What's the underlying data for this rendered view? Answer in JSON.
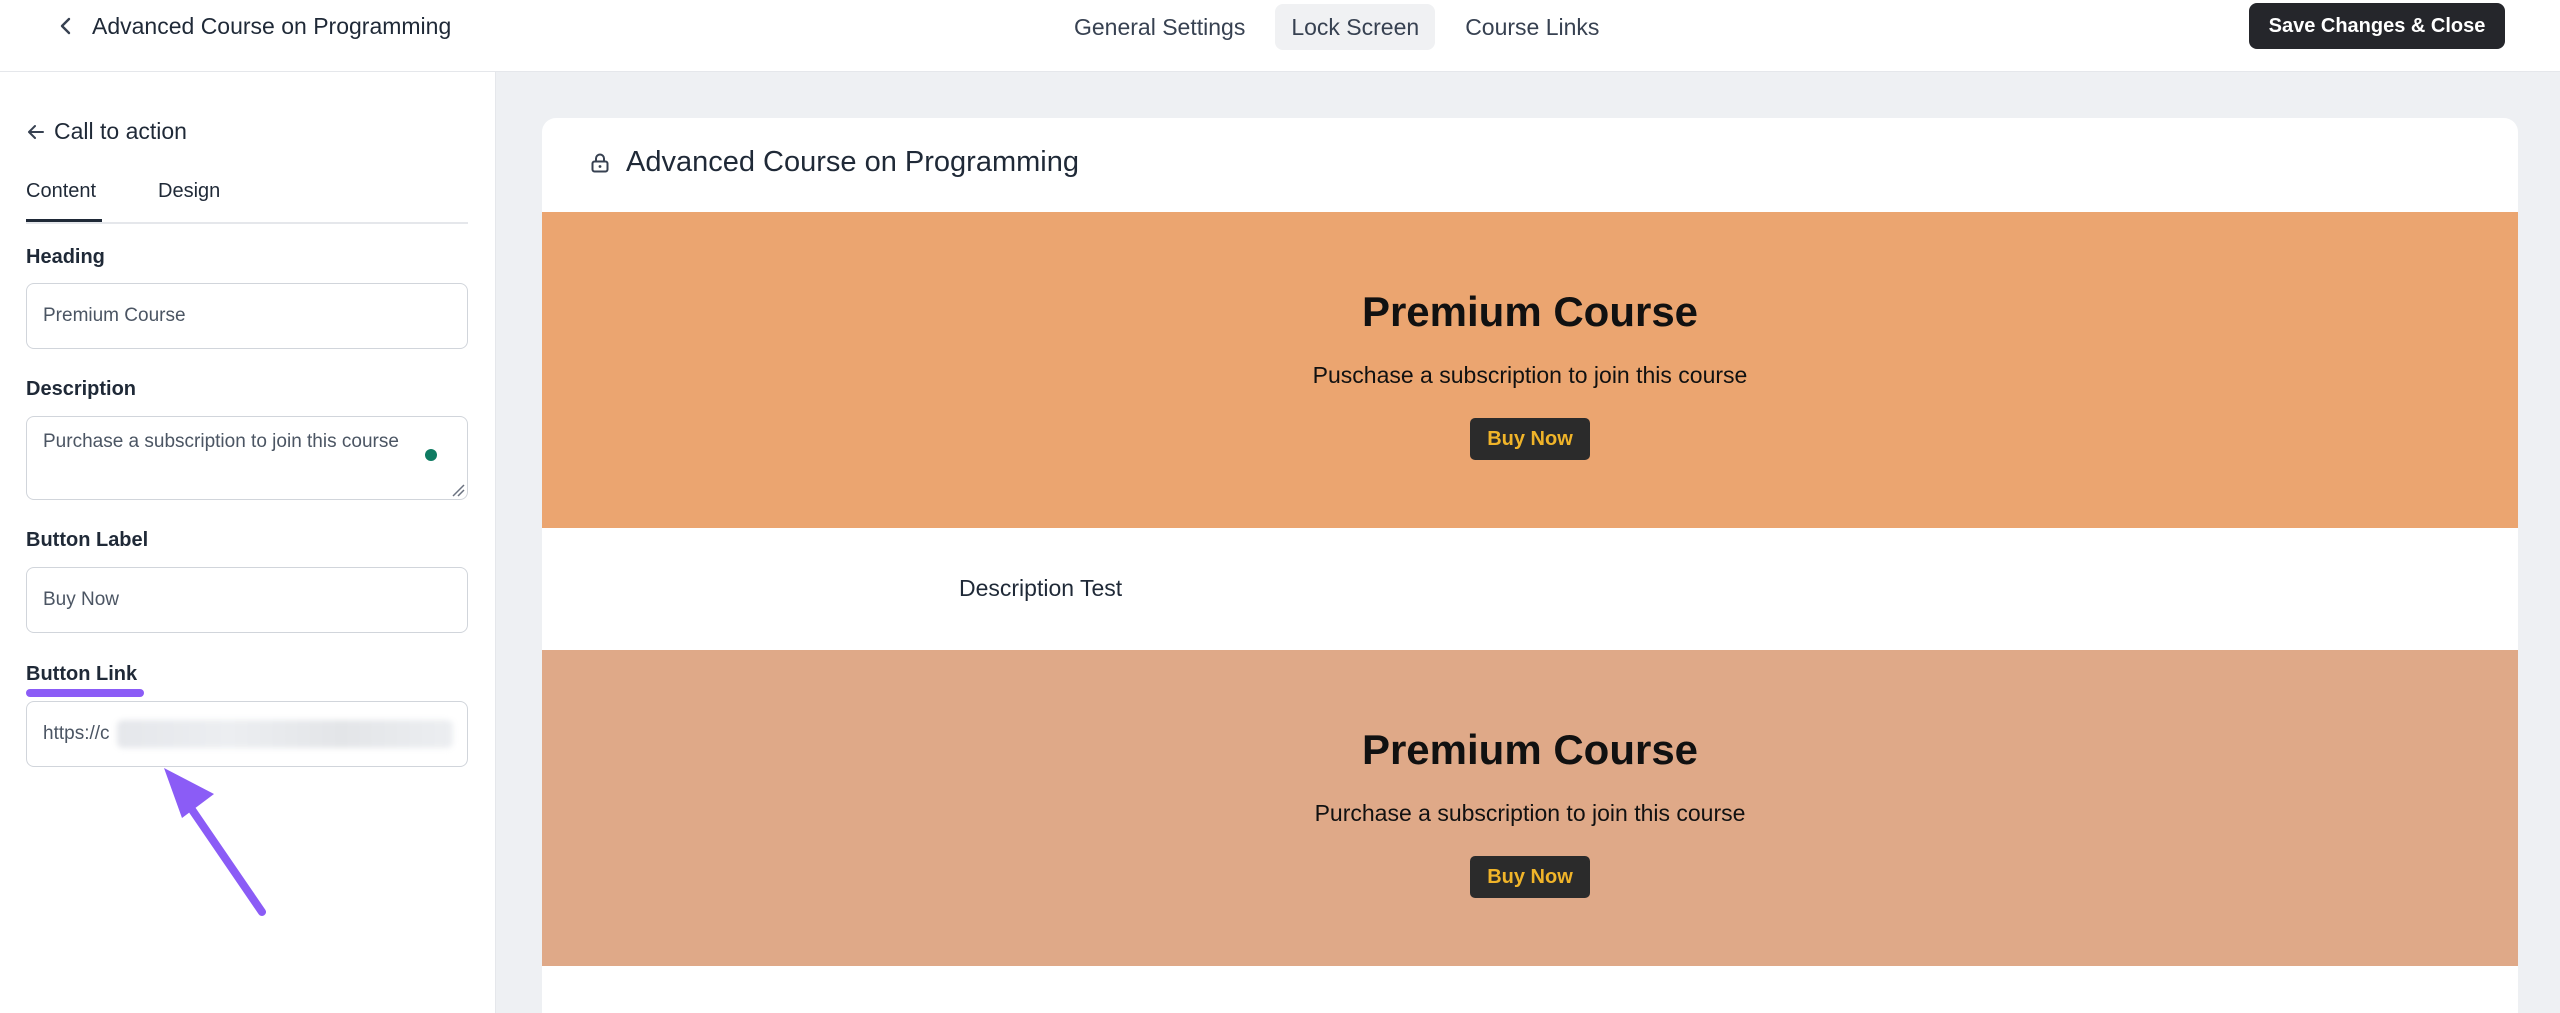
{
  "header": {
    "title": "Advanced Course on Programming",
    "tabs": [
      {
        "label": "General Settings",
        "active": false
      },
      {
        "label": "Lock Screen",
        "active": true
      },
      {
        "label": "Course Links",
        "active": false
      }
    ],
    "save_label": "Save Changes & Close"
  },
  "sidebar": {
    "back_label": "Call to action",
    "tabs": [
      {
        "label": "Content",
        "active": true
      },
      {
        "label": "Design",
        "active": false
      }
    ],
    "fields": {
      "heading": {
        "label": "Heading",
        "value": "Premium Course"
      },
      "description": {
        "label": "Description",
        "value": "Purchase a subscription to join this course"
      },
      "button_label": {
        "label": "Button Label",
        "value": "Buy Now"
      },
      "button_link": {
        "label": "Button Link",
        "value": "https://c"
      }
    }
  },
  "preview": {
    "title": "Advanced Course on Programming",
    "banners": [
      {
        "heading": "Premium Course",
        "subtitle": "Puschase a subscription to join this course",
        "button": "Buy Now",
        "bg": "#eba570"
      },
      {
        "heading": "Premium Course",
        "subtitle": "Purchase a subscription to join this course",
        "button": "Buy Now",
        "bg": "#dfa988"
      }
    ],
    "description_text": "Description Test"
  },
  "colors": {
    "accent_annotation": "#8b5cf6",
    "save_button_bg": "#25262b",
    "buy_button_text": "#f0b429"
  },
  "icons": [
    "chevron-left-icon",
    "arrow-left-icon",
    "lock-icon",
    "annotation-arrow-icon"
  ]
}
